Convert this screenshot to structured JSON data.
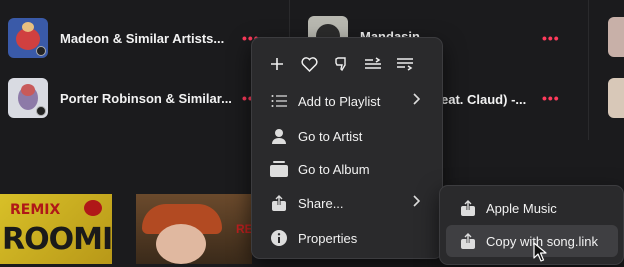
{
  "list": {
    "rows": [
      {
        "title": "Madeon & Similar Artists...",
        "more": "•••"
      },
      {
        "title": "Porter Robinson & Similar...",
        "more": "•••"
      },
      {
        "title": "Mandasin",
        "more": "•••"
      },
      {
        "title": "eat. Claud) -...",
        "more": ""
      }
    ]
  },
  "artwork": {
    "left_label": "REMIX",
    "left_big": "ROOMIN",
    "right_label": "RE"
  },
  "context_menu": {
    "quick_actions": [
      "add-icon",
      "love-icon",
      "dislike-icon",
      "play-next-icon",
      "play-last-icon"
    ],
    "items": [
      {
        "label": "Add to Playlist",
        "icon": "playlist-icon",
        "submenu": true
      },
      {
        "label": "Go to Artist",
        "icon": "artist-icon",
        "submenu": false
      },
      {
        "label": "Go to Album",
        "icon": "album-icon",
        "submenu": false
      },
      {
        "label": "Share...",
        "icon": "share-icon",
        "submenu": true
      },
      {
        "label": "Properties",
        "icon": "info-icon",
        "submenu": false
      }
    ]
  },
  "share_submenu": {
    "items": [
      {
        "label": "Apple Music",
        "icon": "share-icon"
      },
      {
        "label": "Copy with song.link",
        "icon": "share-icon",
        "hovered": true
      }
    ]
  },
  "colors": {
    "accent": "#ff3b5c",
    "background": "#1b1b1d",
    "menu_bg": "#2a2a2c",
    "hover": "#3f3f42"
  }
}
